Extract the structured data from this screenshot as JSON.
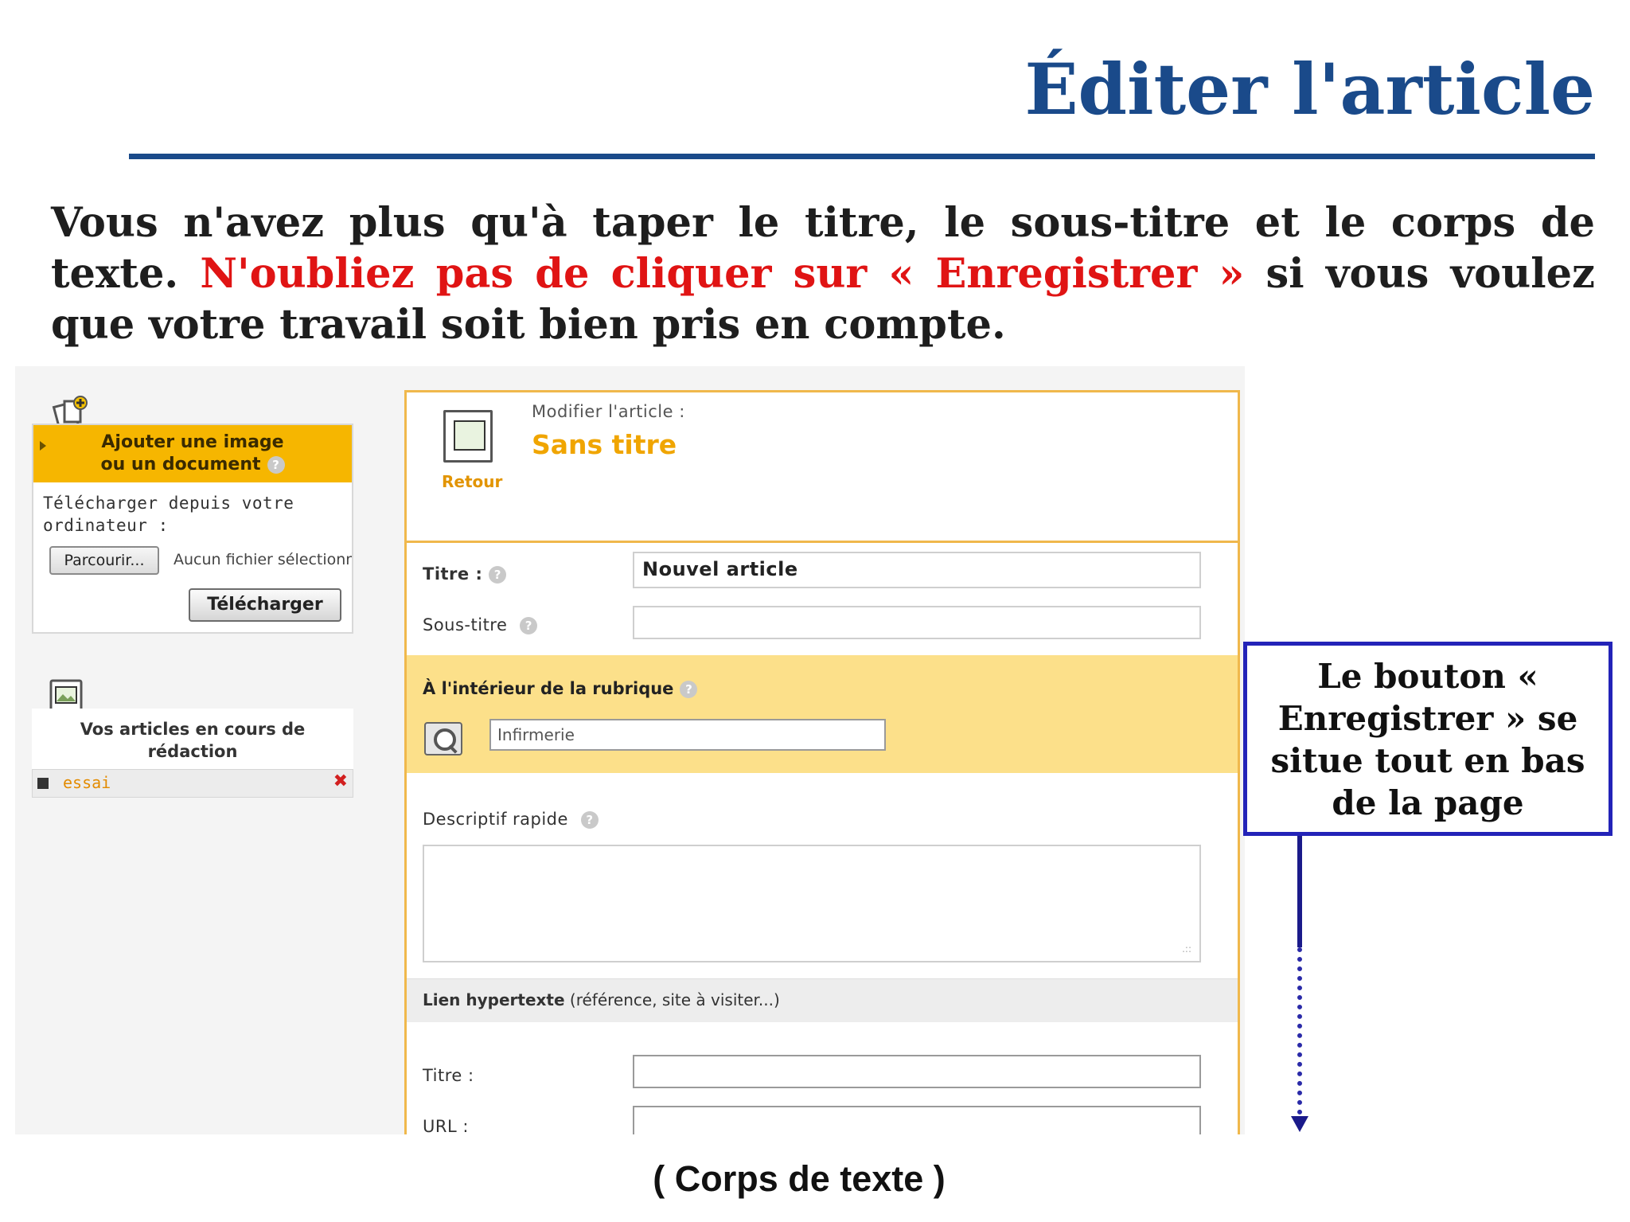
{
  "slide": {
    "title": "Éditer l'article",
    "intro_part1": "Vous n'avez plus qu'à taper le titre, le sous-titre et le corps de texte. ",
    "intro_red": "N'oubliez pas de cliquer sur « Enregistrer »",
    "intro_part2": " si vous voulez que votre travail soit bien pris en compte.",
    "corps_caption": "( Corps de texte )",
    "callout": "Le bouton « Enregistrer » se situe tout en bas de la page"
  },
  "sidebar": {
    "upload_title_line1": "Ajouter une image",
    "upload_title_line2": "ou un document",
    "upload_text_line1": "Télécharger depuis votre",
    "upload_text_line2": "ordinateur :",
    "browse_button": "Parcourir...",
    "no_file": "Aucun fichier sélectionné",
    "upload_button": "Télécharger",
    "drafts_title_line1": "Vos articles en cours de",
    "drafts_title_line2": "rédaction",
    "drafts": [
      {
        "name": "essai",
        "delete": "✖"
      }
    ]
  },
  "form": {
    "retour": "Retour",
    "modifier_label": "Modifier l'article :",
    "article_title": "Sans titre",
    "titre_label": "Titre :",
    "titre_value": "Nouvel article",
    "soustitre_label": "Sous-titre",
    "soustitre_value": "",
    "rubrique_label": "À l'intérieur de la rubrique",
    "rubrique_value": "Infirmerie",
    "descriptif_label": "Descriptif rapide",
    "descriptif_value": "",
    "lien_label_bold": "Lien hypertexte",
    "lien_label_rest": " (référence, site à visiter...)",
    "lien_titre_label": "Titre :",
    "lien_titre_value": "",
    "url_label": "URL :",
    "url_value": "",
    "help_glyph": "?"
  },
  "colors": {
    "title_blue": "#1a4a8a",
    "warning_red": "#e01414",
    "form_border": "#f0b84c",
    "rubrique_band": "#fce08a",
    "orange_text": "#f0a500",
    "callout_border": "#2323b8"
  },
  "icons": [
    "add-document-icon",
    "image-document-icon",
    "help-icon",
    "magnifier-icon",
    "delete-icon",
    "expand-arrow-icon"
  ]
}
